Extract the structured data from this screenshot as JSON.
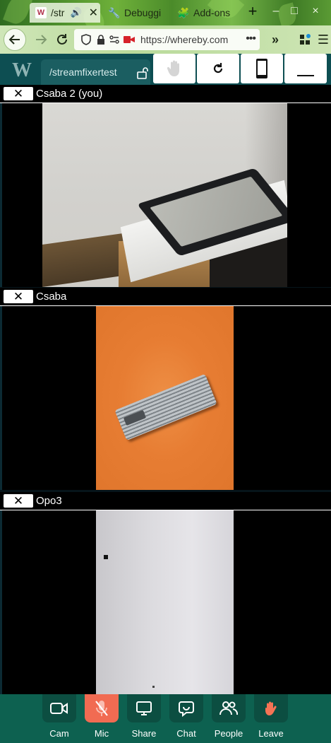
{
  "browser": {
    "tabs": [
      {
        "label": "/str",
        "active": true,
        "favicon": "whereby-w-icon"
      },
      {
        "label": "Debuggi",
        "active": false,
        "favicon": "wrench-icon"
      },
      {
        "label": "Add-ons",
        "active": false,
        "favicon": "puzzle-icon"
      }
    ],
    "new_tab": "+",
    "window_controls": [
      "–",
      "□",
      "×"
    ],
    "url": "https://whereby.com"
  },
  "app": {
    "logo": "W",
    "room_name": "/streamfixertest",
    "top_buttons": [
      {
        "name": "raise-hand-button",
        "icon": "hand-icon"
      },
      {
        "name": "refresh-button",
        "icon": "rotate-icon"
      },
      {
        "name": "phone-layout-button",
        "icon": "phone-icon"
      },
      {
        "name": "minimize-button",
        "icon": "underscore-icon"
      }
    ]
  },
  "participants": [
    {
      "name": "Csaba 2 (you)"
    },
    {
      "name": "Csaba"
    },
    {
      "name": "Opo3"
    }
  ],
  "controls": [
    {
      "label": "Cam",
      "icon": "camera-icon",
      "active": false
    },
    {
      "label": "Mic",
      "icon": "mic-muted-icon",
      "active": true
    },
    {
      "label": "Share",
      "icon": "screen-share-icon",
      "active": false
    },
    {
      "label": "Chat",
      "icon": "chat-icon",
      "active": false
    },
    {
      "label": "People",
      "icon": "people-icon",
      "active": false
    },
    {
      "label": "Leave",
      "icon": "waving-hand-icon",
      "active": false
    }
  ],
  "colors": {
    "app_teal": "#0d4e52",
    "controls_green": "#0d6150",
    "mic_active": "#f16b52"
  }
}
